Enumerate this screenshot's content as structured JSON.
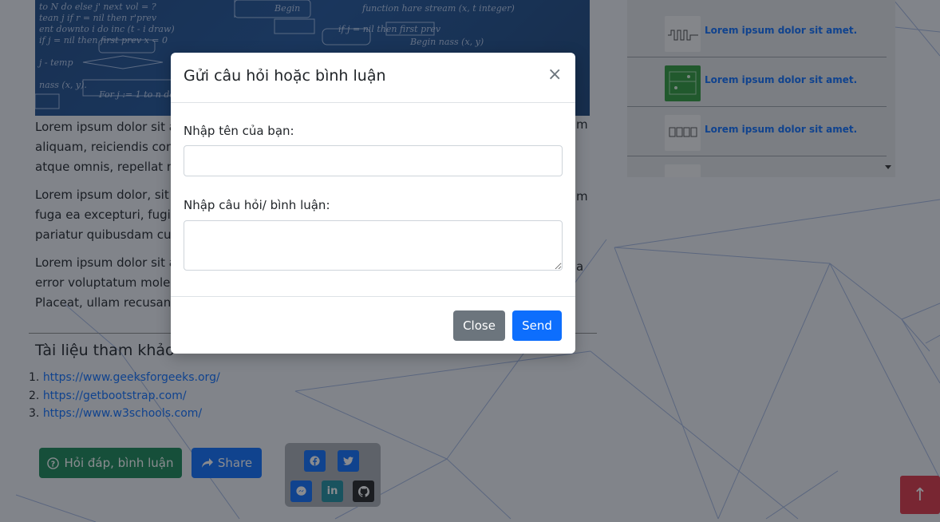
{
  "article": {
    "paragraphs": [
      "Lorem ipsum dolor sit a",
      "aliquam, reiciendis com",
      "atque omnis, repellat no",
      "Lorem ipsum dolor, sit a",
      "fuga ea excepturi, fugit",
      "pariatur quibusdam culp",
      "Lorem ipsum dolor sit a",
      "error voluptatum moles",
      "Placeat, ullam recusand"
    ],
    "right_fragments": [
      "m",
      "m",
      "a"
    ]
  },
  "references": {
    "title": "Tài liệu tham khảo",
    "items": [
      {
        "num": "1.",
        "url": "https://www.geeksforgeeks.org/"
      },
      {
        "num": "2.",
        "url": "https://getbootstrap.com/"
      },
      {
        "num": "3.",
        "url": "https://www.w3schools.com/"
      }
    ]
  },
  "actions": {
    "qa_label": "Hỏi đáp, bình luận",
    "share_label": "Share",
    "qa_icon": "question-circle-icon",
    "share_icon": "share-arrow-icon"
  },
  "social": {
    "buttons": [
      {
        "name": "facebook",
        "glyph": "f",
        "color": "#0d6efd"
      },
      {
        "name": "twitter",
        "glyph": "t",
        "color": "#0d6efd"
      },
      {
        "name": "messenger",
        "glyph": "m",
        "color": "#0d6efd"
      },
      {
        "name": "linkedin",
        "glyph": "in",
        "color": "#1f8f9e"
      },
      {
        "name": "github",
        "glyph": "gh",
        "color": "#222222"
      }
    ]
  },
  "sidebar": {
    "items": [
      {
        "label": "Lorem ipsum dolor sit amet."
      },
      {
        "label": "Lorem ipsum dolor sit amet."
      },
      {
        "label": "Lorem ipsum dolor sit amet."
      }
    ]
  },
  "modal": {
    "title": "Gửi câu hỏi hoặc bình luận",
    "close_symbol": "×",
    "name_label": "Nhập tên của bạn:",
    "name_value": "",
    "comment_label": "Nhập câu hỏi/ bình luận:",
    "comment_value": "",
    "close_button": "Close",
    "send_button": "Send"
  },
  "scroll_top_symbol": "↑",
  "colors": {
    "primary": "#0d6efd",
    "success": "#198754",
    "secondary": "#6c757d",
    "danger": "#dc3545"
  }
}
